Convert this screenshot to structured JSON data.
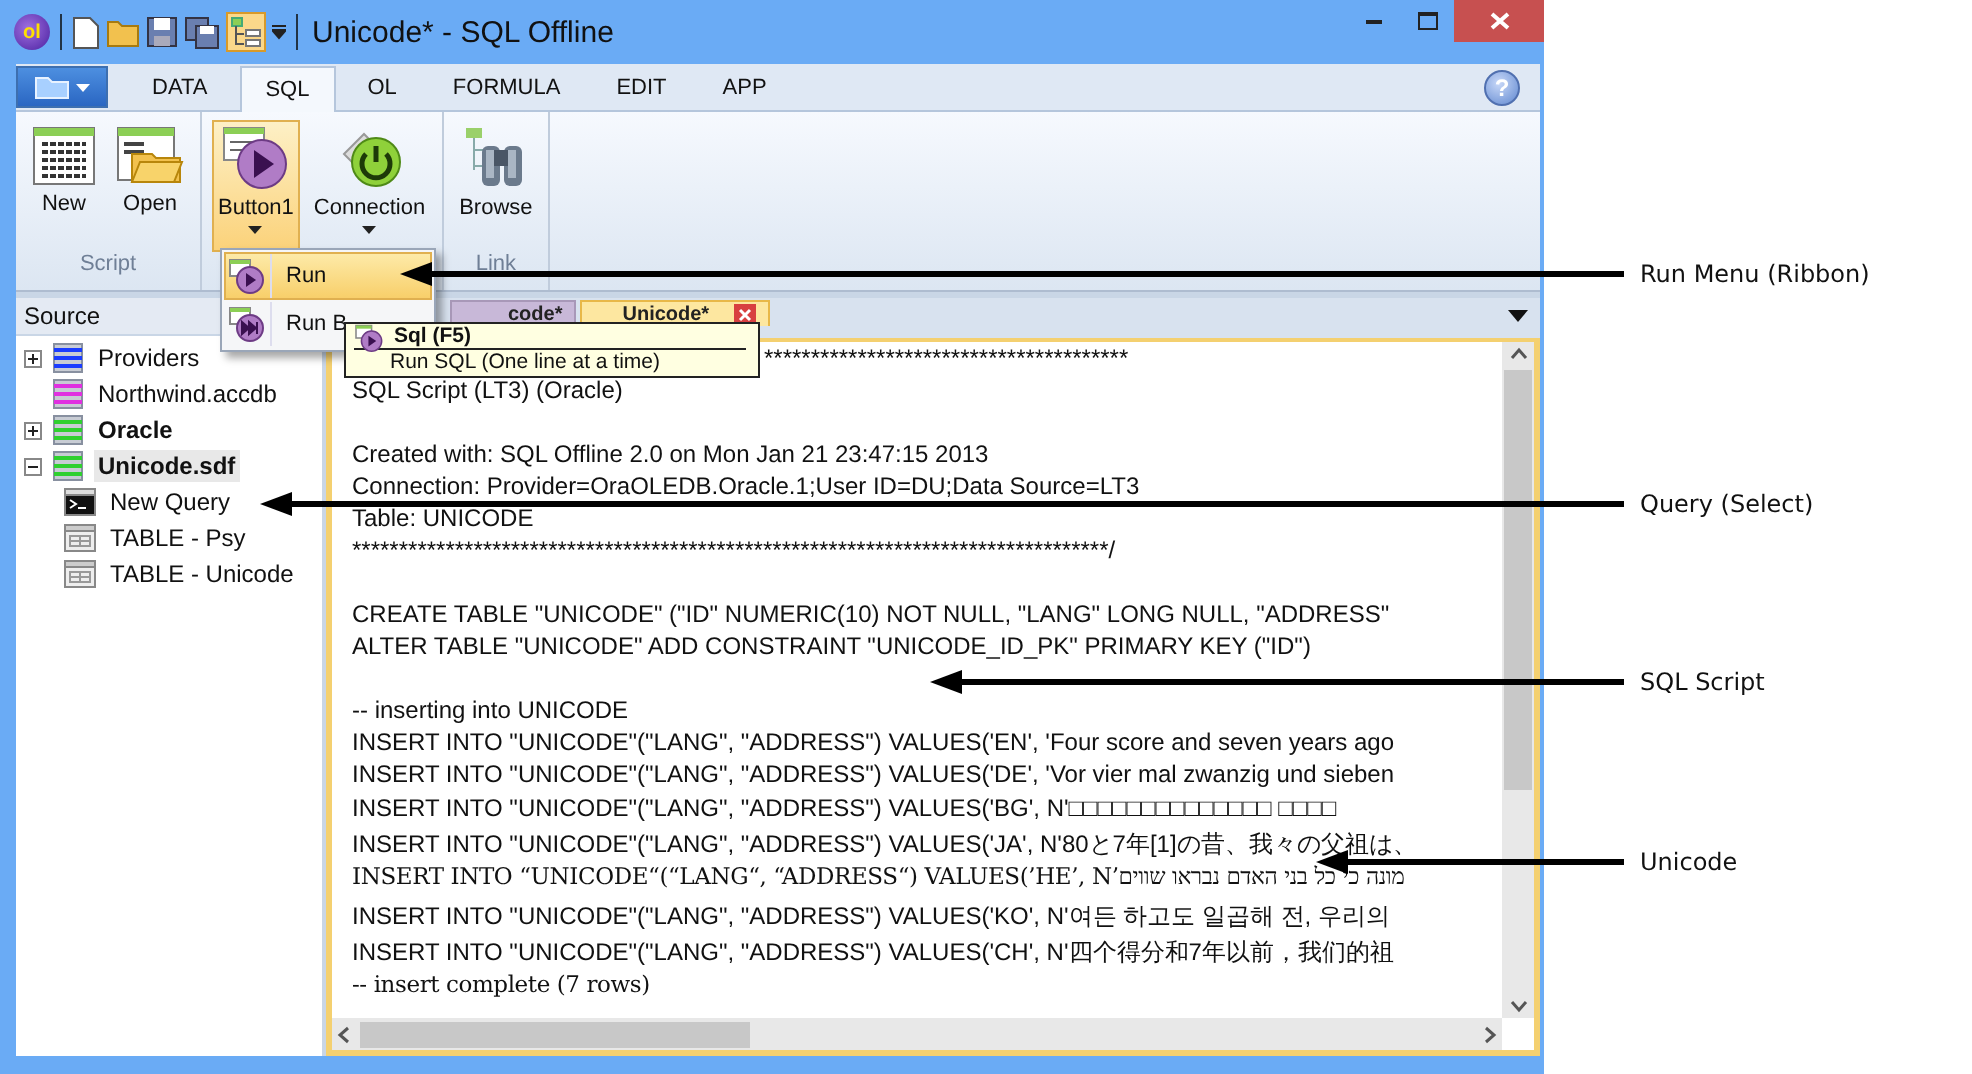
{
  "window": {
    "title": "Unicode* - SQL Offline",
    "app_logo": "ol"
  },
  "ribbon_tabs": [
    {
      "label": "DATA",
      "selected": false
    },
    {
      "label": "SQL",
      "selected": true
    },
    {
      "label": "OL",
      "selected": false
    },
    {
      "label": "FORMULA",
      "selected": false
    },
    {
      "label": "EDIT",
      "selected": false
    },
    {
      "label": "APP",
      "selected": false
    }
  ],
  "help": "?",
  "ribbon_groups": [
    {
      "label": "Script",
      "buttons": [
        {
          "label": "New",
          "kind": "grid",
          "pressed": false,
          "dropdown": false
        },
        {
          "label": "Open",
          "kind": "open",
          "pressed": false,
          "dropdown": false
        }
      ]
    },
    {
      "buttons": [
        {
          "label": "Button1",
          "kind": "run",
          "pressed": true,
          "dropdown": true
        },
        {
          "label": "Connection",
          "kind": "power",
          "pressed": false,
          "dropdown": true
        }
      ]
    },
    {
      "label": "Link",
      "buttons": [
        {
          "label": "Browse",
          "kind": "binoculars",
          "pressed": false,
          "dropdown": false
        }
      ]
    }
  ],
  "run_menu": {
    "items": [
      {
        "label": "Run",
        "kind": "run",
        "selected": true
      },
      {
        "label": "Run B",
        "kind": "runall",
        "selected": false
      }
    ]
  },
  "tooltip": {
    "title": "Sql (F5)",
    "text": "Run SQL (One line at a time)"
  },
  "source_panel": {
    "title": "Source",
    "tree": [
      {
        "label": "Providers",
        "kind": "db",
        "color": "#1a3cff",
        "expanded": false,
        "bold": false,
        "selected": false
      },
      {
        "label": "Northwind.accdb",
        "kind": "db",
        "color": "#e030e0",
        "bold": false,
        "selected": false
      },
      {
        "label": "Oracle",
        "kind": "db",
        "color": "#2fd02f",
        "expanded": false,
        "bold": true,
        "selected": false
      },
      {
        "label": "Unicode.sdf",
        "kind": "db",
        "color": "#2fd02f",
        "expanded": true,
        "bold": true,
        "selected": true,
        "children": [
          {
            "label": "New Query",
            "kind": "query",
            "bold": false,
            "selected": false
          },
          {
            "label": "TABLE - Psy",
            "kind": "table",
            "bold": false,
            "selected": false
          },
          {
            "label": "TABLE - Unicode",
            "kind": "table",
            "bold": false,
            "selected": false
          }
        ]
      }
    ]
  },
  "document_tabs": [
    {
      "label": "code*",
      "selected": false,
      "closable": false
    },
    {
      "label": "Unicode*",
      "selected": true,
      "closable": true
    }
  ],
  "editor_lines": [
    {
      "kind": "tail",
      "text": "***************************************"
    },
    {
      "kind": "sans",
      "text": "SQL Script (LT3) (Oracle)"
    },
    {
      "kind": "blank"
    },
    {
      "kind": "sans",
      "text": "Created with: SQL Offline 2.0 on Mon Jan 21 23:47:15 2013"
    },
    {
      "kind": "sans",
      "text": "Connection: Provider=OraOLEDB.Oracle.1;User ID=DU;Data Source=LT3"
    },
    {
      "kind": "sans",
      "text": "Table: UNICODE"
    },
    {
      "kind": "sans",
      "text": "*********************************************************************************/"
    },
    {
      "kind": "blank"
    },
    {
      "kind": "sans",
      "text": "CREATE TABLE \"UNICODE\" (\"ID\" NUMERIC(10) NOT NULL, \"LANG\" LONG NULL, \"ADDRESS\""
    },
    {
      "kind": "sans",
      "text": "ALTER TABLE \"UNICODE\" ADD CONSTRAINT \"UNICODE_ID_PK\" PRIMARY KEY (\"ID\")"
    },
    {
      "kind": "blank"
    },
    {
      "kind": "sans",
      "text": "-- inserting into UNICODE"
    },
    {
      "kind": "sans",
      "text": "INSERT INTO \"UNICODE\"(\"LANG\", \"ADDRESS\") VALUES('EN', 'Four score and seven years ago"
    },
    {
      "kind": "sans",
      "text": "INSERT INTO \"UNICODE\"(\"LANG\", \"ADDRESS\") VALUES('DE', 'Vor vier mal zwanzig und sieben"
    },
    {
      "kind": "tall",
      "text": "INSERT INTO \"UNICODE\"(\"LANG\", \"ADDRESS\") VALUES('BG', N'□□□□□□□□□□□□□□ □□□□"
    },
    {
      "kind": "tall",
      "text": "INSERT INTO \"UNICODE\"(\"LANG\", \"ADDRESS\") VALUES('JA', N'80と7年[1]の昔、我々の父祖は、"
    },
    {
      "kind": "mono",
      "text": "INSERT INTO “UNICODE“(“LANG“, “ADDRESS“) VALUES(’HE’, N’מונה כי כל בני האדם נבראו שווים"
    },
    {
      "kind": "tall",
      "text": "INSERT INTO \"UNICODE\"(\"LANG\", \"ADDRESS\") VALUES('KO', N'여든 하고도 일곱해 전, 우리의"
    },
    {
      "kind": "tall",
      "text": "INSERT INTO \"UNICODE\"(\"LANG\", \"ADDRESS\") VALUES('CH', N'四个得分和7年以前，我们的祖"
    },
    {
      "kind": "mono",
      "text": "-- insert complete (7 rows)"
    }
  ],
  "callouts": [
    {
      "label": "Run Menu (Ribbon)"
    },
    {
      "label": "Query (Select)"
    },
    {
      "label": "SQL Script"
    },
    {
      "label": "Unicode"
    }
  ]
}
